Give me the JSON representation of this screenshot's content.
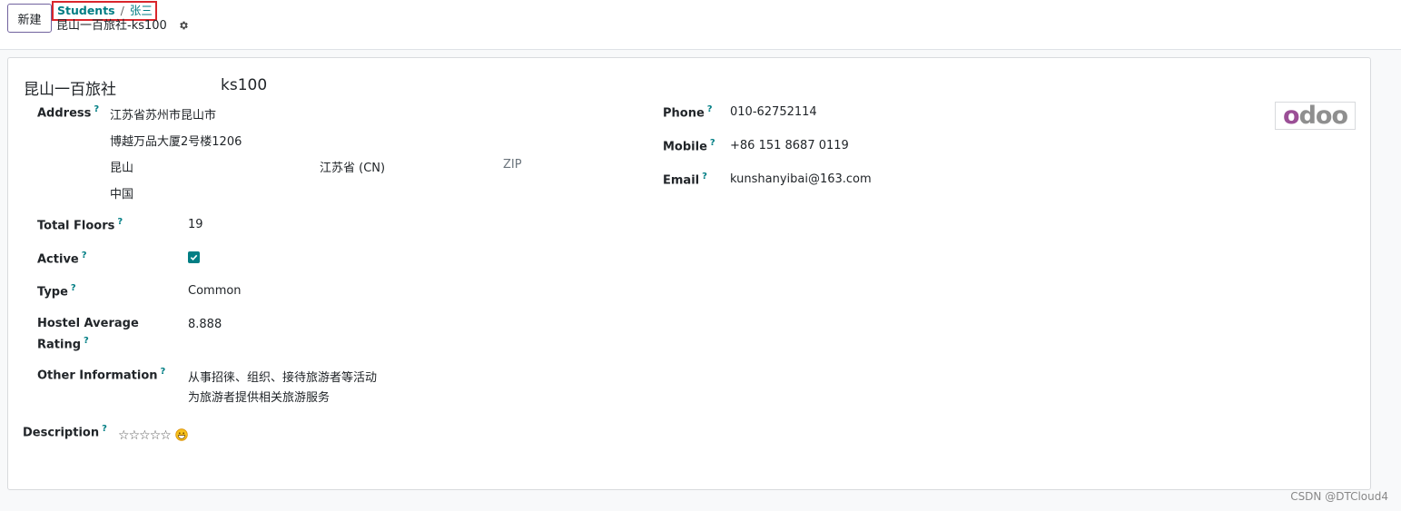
{
  "toolbar": {
    "new_label": "新建"
  },
  "breadcrumb": {
    "parent": "Students",
    "separator": "/",
    "current": "张三"
  },
  "record": {
    "title": "昆山一百旅社-ks100",
    "gear_icon": "gear-icon"
  },
  "form": {
    "name": "昆山一百旅社",
    "code": "ks100",
    "help_mark": "?",
    "address": {
      "label": "Address",
      "street": "江苏省苏州市昆山市",
      "street2": "博越万品大厦2号楼1206",
      "city": "昆山",
      "state": "江苏省 (CN)",
      "zip_placeholder": "ZIP",
      "country": "中国"
    },
    "total_floors": {
      "label": "Total Floors",
      "value": "19"
    },
    "active": {
      "label": "Active",
      "checked": true
    },
    "type": {
      "label": "Type",
      "value": "Common"
    },
    "rating": {
      "label_line1": "Hostel Average",
      "label_line2": "Rating",
      "value": "8.888"
    },
    "other_info": {
      "label": "Other Information",
      "line1": "从事招徕、组织、接待旅游者等活动",
      "line2": "为旅游者提供相关旅游服务"
    },
    "phone": {
      "label": "Phone",
      "value": "010-62752114"
    },
    "mobile": {
      "label": "Mobile",
      "value": "+86 151 8687 0119"
    },
    "email": {
      "label": "Email",
      "value": "kunshanyibai@163.com"
    },
    "description": {
      "label": "Description",
      "stars": [
        "☆",
        "☆",
        "☆",
        "☆",
        "☆"
      ],
      "star_value": 0,
      "emoji_icon": "grinning-face-icon"
    }
  },
  "logo": {
    "prefix": "o",
    "rest": "doo"
  },
  "watermark": "CSDN @DTCloud4",
  "colors": {
    "accent": "#017e84",
    "brand_purple": "#71639e",
    "highlight_red": "#d9262c"
  }
}
